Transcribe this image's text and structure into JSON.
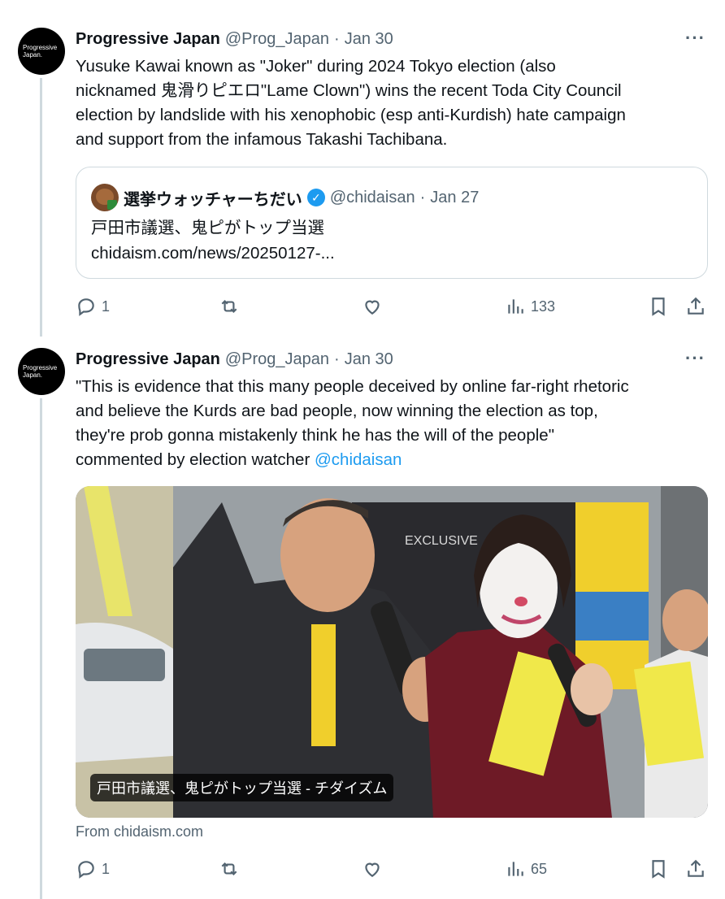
{
  "tweets": [
    {
      "avatar_text": [
        "Progressive",
        "Japan."
      ],
      "name": "Progressive Japan",
      "handle": "@Prog_Japan",
      "sep": "·",
      "date": "Jan 30",
      "more": "···",
      "text_lines": [
        "Yusuke Kawai known as \"Joker\" during 2024 Tokyo election (also",
        "nicknamed 鬼滑りピエロ\"Lame Clown\") wins the recent Toda City Council",
        "election by landslide with his xenophobic (esp anti-Kurdish) hate campaign",
        "and support from the infamous Takashi Tachibana."
      ],
      "quote": {
        "name": "選挙ウォッチャーちだい",
        "verified_icon": "✓",
        "handle": "@chidaisan",
        "sep": "·",
        "date": "Jan 27",
        "line1": "戸田市議選、鬼ピがトップ当選",
        "line2": "chidaism.com/news/20250127-..."
      },
      "actions": {
        "replies": "1",
        "reposts": "",
        "likes": "",
        "views": "133"
      }
    },
    {
      "avatar_text": [
        "Progressive",
        "Japan."
      ],
      "name": "Progressive Japan",
      "handle": "@Prog_Japan",
      "sep": "·",
      "date": "Jan 30",
      "more": "···",
      "text_lines": [
        "\"This is evidence that this many people deceived by online far-right rhetoric",
        "and believe the Kurds are bad people, now winning the election as top,",
        "they're prob gonna mistakenly think he has the will of the people\""
      ],
      "text_last_prefix": "commented by election watcher ",
      "text_last_link": "@chidaisan",
      "card": {
        "caption": "戸田市議選、鬼ピがトップ当選 - チダイズム",
        "from": "From chidaism.com",
        "banner_text": "EXCLUSIVE"
      },
      "actions": {
        "replies": "1",
        "reposts": "",
        "likes": "",
        "views": "65"
      }
    }
  ],
  "colors": {
    "accent": "#1d9bf0",
    "muted": "#536471",
    "border": "#cfd9de"
  }
}
